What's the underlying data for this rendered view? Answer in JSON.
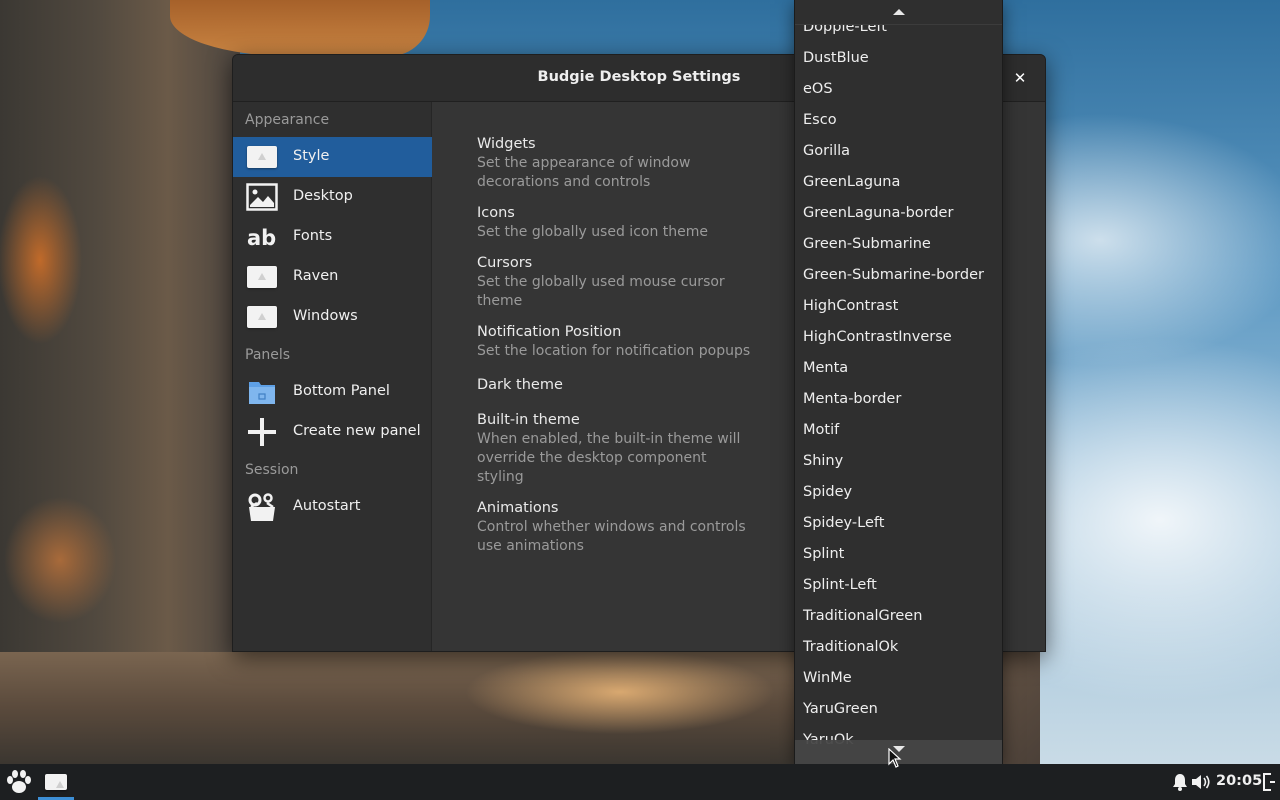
{
  "window": {
    "title": "Budgie Desktop Settings",
    "close_glyph": "✕"
  },
  "sidebar": {
    "sections": [
      {
        "header": "Appearance"
      },
      {
        "header": "Panels"
      },
      {
        "header": "Session"
      }
    ],
    "items": [
      {
        "label": "Style",
        "icon": "theme-icon",
        "selected": true
      },
      {
        "label": "Desktop",
        "icon": "desktop-image-icon"
      },
      {
        "label": "Fonts",
        "icon": "fonts-ab-icon"
      },
      {
        "label": "Raven",
        "icon": "theme-icon"
      },
      {
        "label": "Windows",
        "icon": "theme-icon"
      },
      {
        "label": "Bottom Panel",
        "icon": "folder-panel-icon"
      },
      {
        "label": "Create new panel",
        "icon": "plus-icon"
      },
      {
        "label": "Autostart",
        "icon": "gears-box-icon"
      }
    ]
  },
  "options": [
    {
      "title": "Widgets",
      "desc": "Set the appearance of window decorations and controls"
    },
    {
      "title": "Icons",
      "desc": "Set the globally used icon theme"
    },
    {
      "title": "Cursors",
      "desc": "Set the globally used mouse cursor theme"
    },
    {
      "title": "Notification Position",
      "desc": "Set the location for notification popups"
    },
    {
      "title": "Dark theme",
      "desc": ""
    },
    {
      "title": "Built-in theme",
      "desc": "When enabled, the built-in theme will override the desktop component styling"
    },
    {
      "title": "Animations",
      "desc": "Control whether windows and controls use animations"
    }
  ],
  "theme_popup": {
    "items": [
      "Dopple-Left",
      "DustBlue",
      "eOS",
      "Esco",
      "Gorilla",
      "GreenLaguna",
      "GreenLaguna-border",
      "Green-Submarine",
      "Green-Submarine-border",
      "HighContrast",
      "HighContrastInverse",
      "Menta",
      "Menta-border",
      "Motif",
      "Shiny",
      "Spidey",
      "Spidey-Left",
      "Splint",
      "Splint-Left",
      "TraditionalGreen",
      "TraditionalOk",
      "WinMe",
      "YaruGreen",
      "YaruOk"
    ]
  },
  "taskbar": {
    "clock": "20:05",
    "menu_icon": "budgie-paw-icon",
    "app_icon": "settings-window-icon",
    "tray_icons": [
      "bell-icon",
      "volume-icon",
      "power-icon"
    ]
  },
  "colors": {
    "selection": "#215d9c",
    "window_bg": "#353535",
    "sidebar_bg": "#2f2f2f",
    "taskbar_bg": "#1d1f21",
    "accent": "#3d8fd6"
  }
}
